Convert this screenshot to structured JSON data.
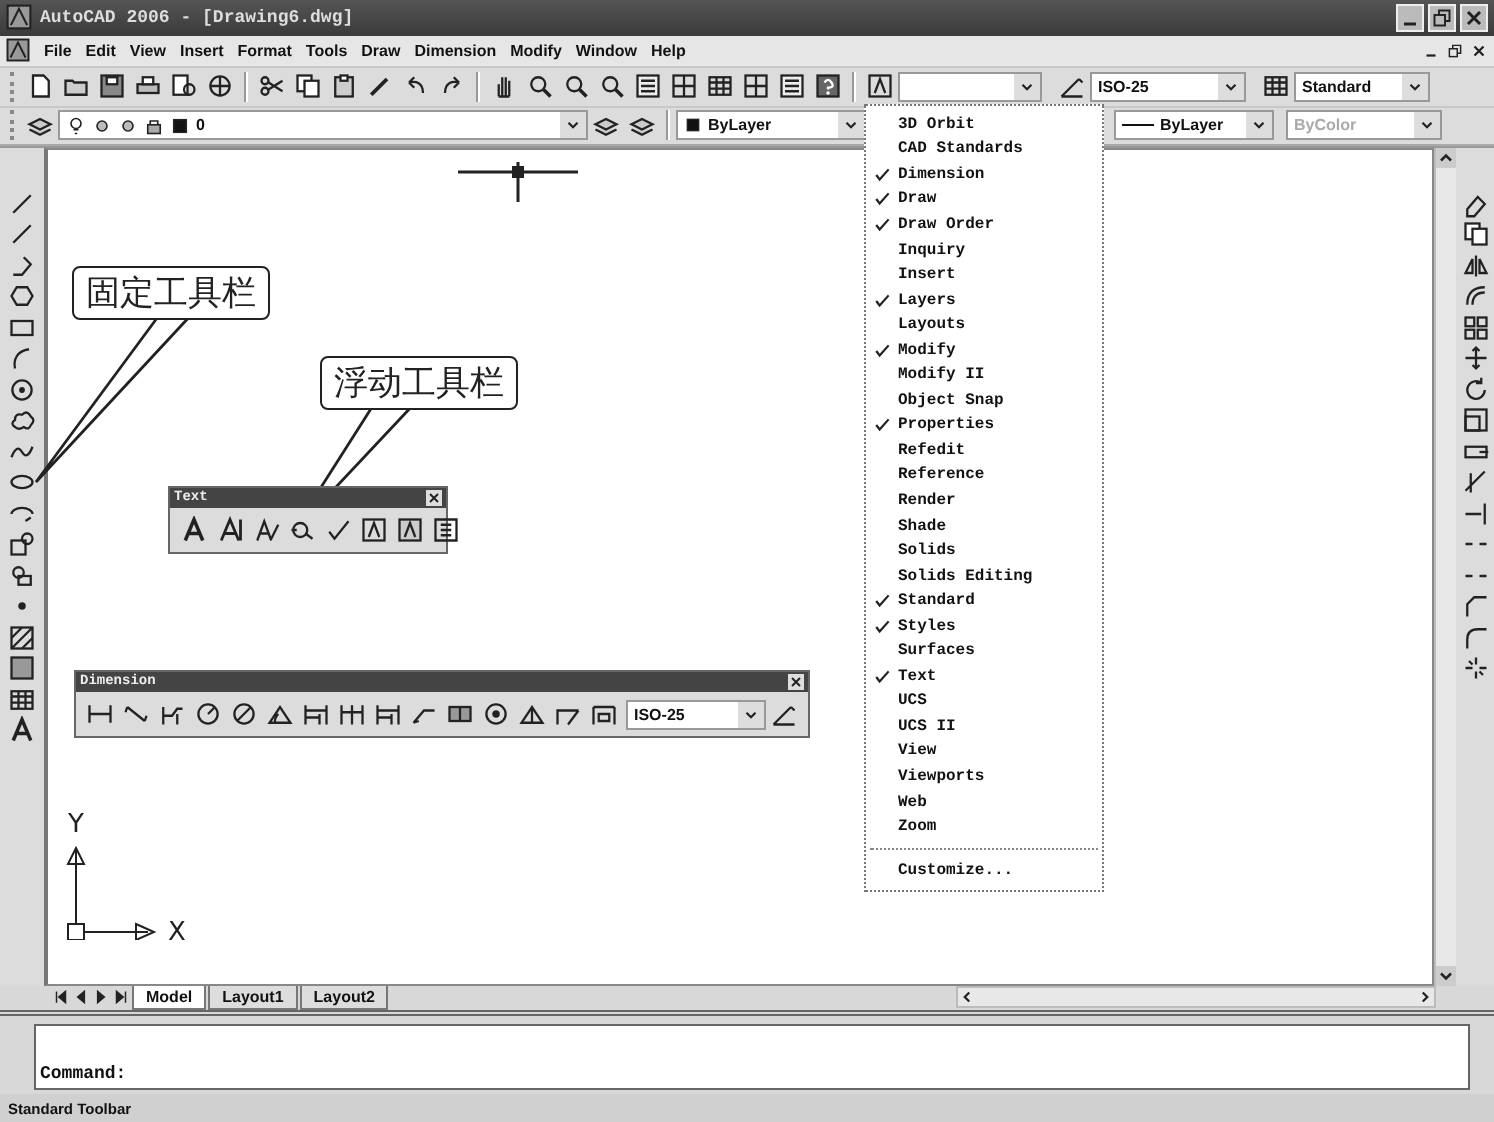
{
  "window": {
    "title": "AutoCAD 2006 - [Drawing6.dwg]"
  },
  "menu_bar": [
    "File",
    "Edit",
    "View",
    "Insert",
    "Format",
    "Tools",
    "Draw",
    "Dimension",
    "Modify",
    "Window",
    "Help"
  ],
  "standard_toolbar": {
    "dim_style": "ISO-25",
    "table_style": "Standard"
  },
  "properties_toolbar": {
    "layer": "0",
    "color_setting": "ByLayer",
    "lineweight": "ByLayer",
    "plot_style": {
      "label": "ByColor",
      "disabled": true
    }
  },
  "callouts": [
    "固定工具栏",
    "浮动工具栏"
  ],
  "text_toolbar": {
    "title": "Text"
  },
  "dimension_toolbar": {
    "title": "Dimension",
    "dim_style": "ISO-25"
  },
  "toolbar_menu": {
    "items": [
      {
        "label": "3D Orbit",
        "checked": false
      },
      {
        "label": "CAD Standards",
        "checked": false
      },
      {
        "label": "Dimension",
        "checked": true
      },
      {
        "label": "Draw",
        "checked": true
      },
      {
        "label": "Draw Order",
        "checked": true
      },
      {
        "label": "Inquiry",
        "checked": false
      },
      {
        "label": "Insert",
        "checked": false
      },
      {
        "label": "Layers",
        "checked": true
      },
      {
        "label": "Layouts",
        "checked": false
      },
      {
        "label": "Modify",
        "checked": true
      },
      {
        "label": "Modify II",
        "checked": false
      },
      {
        "label": "Object Snap",
        "checked": false
      },
      {
        "label": "Properties",
        "checked": true
      },
      {
        "label": "Refedit",
        "checked": false
      },
      {
        "label": "Reference",
        "checked": false
      },
      {
        "label": "Render",
        "checked": false
      },
      {
        "label": "Shade",
        "checked": false
      },
      {
        "label": "Solids",
        "checked": false
      },
      {
        "label": "Solids Editing",
        "checked": false
      },
      {
        "label": "Standard",
        "checked": true
      },
      {
        "label": "Styles",
        "checked": true
      },
      {
        "label": "Surfaces",
        "checked": false
      },
      {
        "label": "Text",
        "checked": true
      },
      {
        "label": "UCS",
        "checked": false
      },
      {
        "label": "UCS II",
        "checked": false
      },
      {
        "label": "View",
        "checked": false
      },
      {
        "label": "Viewports",
        "checked": false
      },
      {
        "label": "Web",
        "checked": false
      },
      {
        "label": "Zoom",
        "checked": false
      }
    ],
    "customize": "Customize..."
  },
  "ucs_icon": {
    "y_label": "Y",
    "x_label": "X"
  },
  "layout_tabs": [
    {
      "label": "Model",
      "selected": true
    },
    {
      "label": "Layout1",
      "selected": false
    },
    {
      "label": "Layout2",
      "selected": false
    }
  ],
  "command_line": {
    "prompt": "Command:"
  },
  "status_bar": {
    "text": "Standard Toolbar"
  }
}
